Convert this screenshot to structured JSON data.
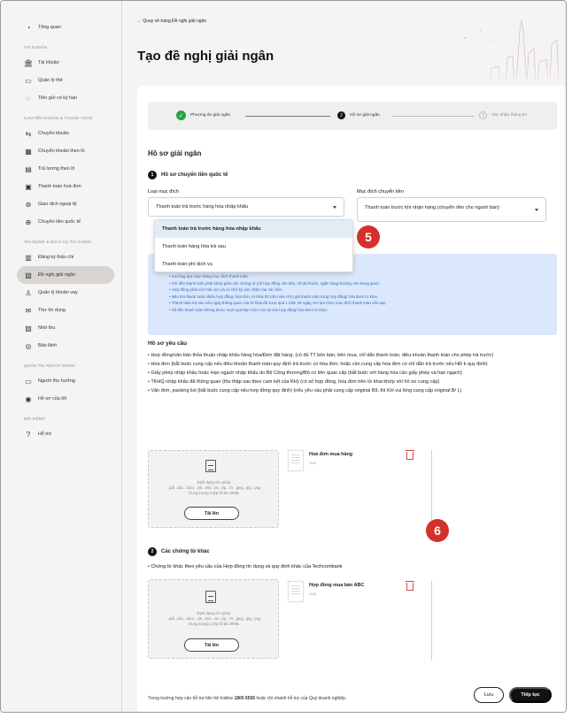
{
  "sidebar": {
    "top_item": {
      "label": "Tổng quan",
      "icon": "chart-pie-icon"
    },
    "sections": [
      {
        "title": "TÀI KHOẢN",
        "items": [
          {
            "label": "Tài khoản",
            "icon": "bank-icon"
          },
          {
            "label": "Quản lý thẻ",
            "icon": "card-icon"
          },
          {
            "label": "Tiền gửi có kỳ hạn",
            "icon": "savings-icon"
          }
        ]
      },
      {
        "title": "CHUYỂN KHOẢN & THANH TOÁN",
        "items": [
          {
            "label": "Chuyển khoản",
            "icon": "transfer-icon"
          },
          {
            "label": "Chuyển khoản theo lô",
            "icon": "batch-icon"
          },
          {
            "label": "Trả lương theo lô",
            "icon": "payroll-icon"
          },
          {
            "label": "Thanh toán hoá đơn",
            "icon": "bill-icon"
          },
          {
            "label": "Giao dịch ngoại tệ",
            "icon": "fx-icon"
          },
          {
            "label": "Chuyển tiền quốc tế",
            "icon": "globe-icon"
          }
        ]
      },
      {
        "title": "TÍN DỤNG & DỊCH VỤ TÀI CHÍNH",
        "items": [
          {
            "label": "Đăng ký thấu chi",
            "icon": "overdraft-icon"
          },
          {
            "label": "Đề nghị giải ngân",
            "icon": "disbursement-icon",
            "active": true
          },
          {
            "label": "Quản lý khoản vay",
            "icon": "loan-icon"
          },
          {
            "label": "Thư tín dụng",
            "icon": "letter-icon"
          },
          {
            "label": "Nhờ thu",
            "icon": "collection-icon"
          },
          {
            "label": "Bảo lãnh",
            "icon": "guarantee-icon"
          }
        ]
      },
      {
        "title": "QUẢN TRỊ NGƯỜI DÙNG",
        "items": [
          {
            "label": "Người thụ hưởng",
            "icon": "beneficiary-icon"
          },
          {
            "label": "Hồ sơ của tôi",
            "icon": "profile-icon"
          }
        ]
      },
      {
        "title": "MỞ RỘNG",
        "items": [
          {
            "label": "Hỗ trợ",
            "icon": "help-icon"
          }
        ]
      }
    ]
  },
  "header": {
    "back_link": "← Quay về trang Đề nghị giải ngân",
    "title": "Tạo đề nghị giải ngân"
  },
  "stepper": {
    "steps": [
      {
        "label": "Phương án giải ngân",
        "status": "done"
      },
      {
        "label": "Hồ sơ giải ngân",
        "status": "current",
        "number": "2"
      },
      {
        "label": "Xác nhận thông tin",
        "status": "pending",
        "number": "3"
      }
    ]
  },
  "form": {
    "heading": "Hồ sơ giải ngân",
    "section1": {
      "number": "1",
      "title": "Hồ sơ chuyển tiền quốc tế"
    },
    "purpose_type": {
      "label": "Loại mục đích",
      "value": "Thanh toán trả trước hàng hóa nhập khẩu",
      "options": [
        "Thanh toán trả trước hàng hóa nhập khẩu",
        "Thanh toán hàng hóa trả sau",
        "Thanh toán phí dịch vụ"
      ]
    },
    "transfer_purpose": {
      "label": "Mục đích chuyển tiền",
      "value": "Thanh toán trước khi nhận hàng (chuyển tiền cho người bán)"
    },
    "info_notes": [
      "Vui lòng lựa chọn đúng mục đích thanh toán.",
      "Chỉ dẫn thanh toán phải khớp giữa các chứng từ (số hợp đồng, tên bên, số tài khoản, ngân hàng hưởng, NH trung gian).",
      "Hợp đồng phải còn hiệu lực và có chữ ký xác nhận của các bên.",
      "Nếu KH thanh toán nhiều hợp đồng, hóa đơn, tờ khai thì cần note rõ trị giá thanh toán từng hợp đồng/ hóa đơn/ tờ khai.",
      "Thanh toán trả sau nếu ngày thông quan của tờ khai đã vượt quá 1 năm 45 ngày, KH lựa chọn mục đích thanh toán vốn vay.",
      "Số tiền thanh toán không được vượt quá hạn mức còn lại của hợp đồng/ hóa đơn/ tờ khai."
    ],
    "requirements_title": "Hồ sơ yêu cầu",
    "requirements": [
      "• Hợp đồng/văn bản thỏa thuận nhập khẩu hàng hóa/Đơn đặt hàng; (có đủ TT bên bán, bên mua, chỉ dẫn thanh toán, điều khoản thanh toán cho phép trả trước)",
      "• Hóa đơn (bắt buộc cung cấp nếu điều khoản thanh toán quy định trả trước có hóa đơn; hoặc cần cung cấp hóa đơn có chỉ dẫn trả trước nếu HĐ k quy định)",
      "• Giấy phép nhập khẩu hoặc Hạn ngạch nhập khẩu do Bộ Công thương/Bộ có liên quan cấp (bắt buộc với hàng hóa cần giấy phép và hạn ngạch)",
      "• TKHQ nhập khẩu đã thông quan (thu thập sau theo cam kết của KH) (có số hợp đồng, hóa đơn trên tờ khai khớp với hồ sơ cung cấp)",
      "• Vận đơn, packing list (bắt buộc cung cấp nếu hợp đồng quy định) (nếu yêu cầu phải cung cấp original B/L thì KH vui lòng cung cấp original B/ L)"
    ],
    "upload1": {
      "format_text": "Định dạng cho phép:",
      "formats": ".pdf, .doc, .docx, .xls, .xlsx, .txt, .zip, .7z, .jpeg, .jpg, .png",
      "limit": "Dung lượng 1 tệp tối đa 20MB.",
      "button": "Tải lên",
      "file": {
        "name": "Hoá đơn mua hàng",
        "size": "3MB"
      }
    },
    "section2": {
      "number": "2",
      "title": "Các chứng từ khác"
    },
    "section2_note": "• Chứng từ khác theo yêu cầu của Hợp đồng tín dụng và quy định khác của Techcombank",
    "upload2": {
      "format_text": "Định dạng cho phép:",
      "formats": ".pdf, .doc, .docx, .xls, .xlsx, .txt, .zip, .7z, .jpeg, .jpg, .png",
      "limit": "Dung lượng 1 tệp tối đa 20MB.",
      "button": "Tải lên",
      "file": {
        "name": "Hợp đồng mua bán ABC",
        "size": "3MB"
      }
    }
  },
  "footer": {
    "text_before": "Trong trường hợp cần hỗ trợ liên hệ hotline ",
    "hotline": "1800 6556",
    "text_after": " hoặc chi nhánh hỗ trợ của Quý doanh nghiệp.",
    "save": "Lưu",
    "next": "Tiếp tục"
  },
  "annotations": {
    "badge5": "5",
    "badge6": "6"
  },
  "colors": {
    "accent_red": "#d5302c",
    "success_green": "#27a243",
    "info_bg": "#dbe8fb",
    "info_text": "#3367c4"
  }
}
